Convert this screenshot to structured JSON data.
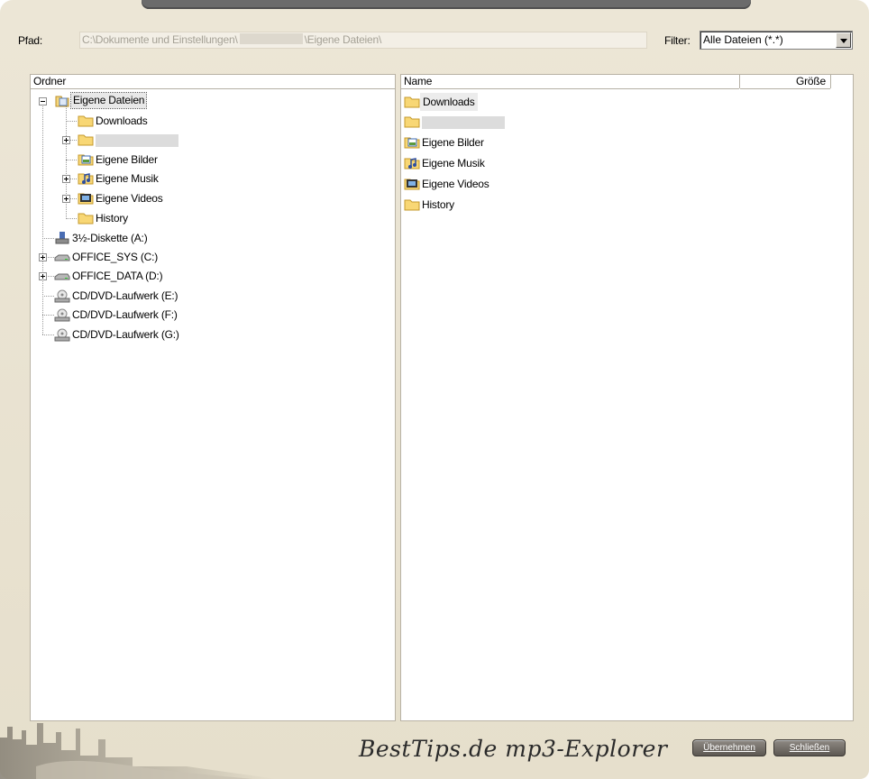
{
  "toolbar": {
    "path_label": "Pfad:",
    "path_prefix": "C:\\Dokumente und Einstellungen\\",
    "path_suffix": "\\Eigene Dateien\\",
    "filter_label": "Filter:",
    "filter_value": "Alle Dateien (*.*)"
  },
  "folder_pane": {
    "header": "Ordner",
    "items": [
      {
        "label": "Eigene Dateien",
        "icon": "my-documents-icon"
      },
      {
        "label": "Downloads",
        "icon": "folder-icon"
      },
      {
        "label": "",
        "icon": "folder-icon"
      },
      {
        "label": "Eigene Bilder",
        "icon": "my-pictures-icon"
      },
      {
        "label": "Eigene Musik",
        "icon": "my-music-icon"
      },
      {
        "label": "Eigene Videos",
        "icon": "my-videos-icon"
      },
      {
        "label": "History",
        "icon": "folder-icon"
      },
      {
        "label": "3½-Diskette (A:)",
        "icon": "floppy-drive-icon"
      },
      {
        "label": "OFFICE_SYS (C:)",
        "icon": "hard-drive-icon"
      },
      {
        "label": "OFFICE_DATA (D:)",
        "icon": "hard-drive-icon"
      },
      {
        "label": "CD/DVD-Laufwerk (E:)",
        "icon": "cd-drive-icon"
      },
      {
        "label": "CD/DVD-Laufwerk (F:)",
        "icon": "cd-drive-icon"
      },
      {
        "label": "CD/DVD-Laufwerk (G:)",
        "icon": "cd-drive-icon"
      }
    ]
  },
  "file_pane": {
    "columns": {
      "name": "Name",
      "size": "Größe"
    },
    "items": [
      {
        "label": "Downloads",
        "icon": "folder-icon"
      },
      {
        "label": "",
        "icon": "folder-icon"
      },
      {
        "label": "Eigene Bilder",
        "icon": "my-pictures-icon"
      },
      {
        "label": "Eigene Musik",
        "icon": "my-music-icon"
      },
      {
        "label": "Eigene Videos",
        "icon": "my-videos-icon"
      },
      {
        "label": "History",
        "icon": "folder-icon"
      }
    ]
  },
  "footer": {
    "brand": "BestTips.de mp3-Explorer",
    "apply_label": "Übernehmen",
    "close_label": "Schließen"
  },
  "colors": {
    "frame": "#e8e2d0",
    "selection": "#e8e8e8",
    "button": "#6e6a64"
  }
}
